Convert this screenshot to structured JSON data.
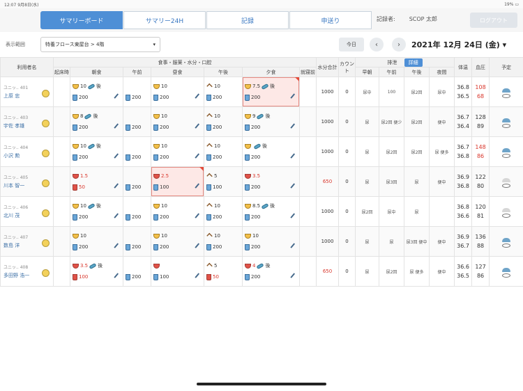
{
  "statusbar": {
    "time": "12:07  9月8日(水)",
    "battery": "19% ▭"
  },
  "tabs": [
    {
      "label": "サマリーボード"
    },
    {
      "label": "サマリー24H"
    },
    {
      "label": "記録"
    },
    {
      "label": "申送り"
    }
  ],
  "recorder": {
    "label": "記録者:",
    "name": "SCOP 太郎"
  },
  "logout_label": "ログアウト",
  "filter": {
    "label": "表示範囲",
    "value": "特養フロース東屋台 > 4階",
    "today_label": "今日"
  },
  "date": "2021年 12月 24日 (金) ▾",
  "headers": {
    "resident": "利用者名",
    "meal_group": "食事・服薬・水分・口腔",
    "wakeup": "起床時",
    "breakfast": "朝食",
    "am": "午前",
    "lunch": "昼食",
    "pm": "午後",
    "dinner": "夕食",
    "bedtime": "就寝前",
    "water_total": "水分合計",
    "count": "カウント",
    "excretion_group": "排泄",
    "detail": "詳細",
    "early": "早朝",
    "ex_am": "午前",
    "ex_pm": "午後",
    "night": "夜間",
    "temp": "体温",
    "bp": "血圧",
    "plan": "予定"
  },
  "rows": [
    {
      "unit": "ユニッ.. 401",
      "name": "上原 忠",
      "breakfast": [
        "10",
        "後",
        "200"
      ],
      "am": "200",
      "lunch": [
        "10",
        "200"
      ],
      "pm": [
        "10",
        "200"
      ],
      "dinner": [
        "7.5",
        "後",
        "200"
      ],
      "water_total": "1000",
      "count": "0",
      "early": "尿中",
      "ex_am": "100",
      "ex_pm": "尿2回",
      "night": "尿中",
      "temp": [
        "36.8",
        "36.5"
      ],
      "bp": [
        "108",
        "68"
      ],
      "bp_red": true
    },
    {
      "unit": "ユニッ.. 403",
      "name": "宇佐 孝雄",
      "breakfast": [
        "8",
        "後",
        "200"
      ],
      "am": "200",
      "lunch": [
        "10",
        "200"
      ],
      "pm": [
        "10",
        "200"
      ],
      "dinner": [
        "9",
        "後",
        "200"
      ],
      "water_total": "1000",
      "count": "0",
      "early": "尿",
      "ex_am": "尿2回 便少",
      "ex_pm": "尿2回",
      "night": "便中",
      "temp": [
        "36.7",
        "36.4"
      ],
      "bp": [
        "128",
        "89"
      ],
      "bp_red": false
    },
    {
      "unit": "ユニッ.. 404",
      "name": "小沢 勲",
      "breakfast": [
        "10",
        "後",
        "200"
      ],
      "am": "200",
      "lunch": [
        "10",
        "200"
      ],
      "pm": [
        "10",
        "200"
      ],
      "dinner": [
        "",
        "後",
        "200"
      ],
      "water_total": "1000",
      "count": "0",
      "early": "尿",
      "ex_am": "尿2回",
      "ex_pm": "尿2回",
      "night": "尿 便多",
      "temp": [
        "36.7",
        "36.8"
      ],
      "bp": [
        "148",
        "86"
      ],
      "bp_red": true
    },
    {
      "unit": "ユニッ.. 405",
      "name": "川本 智一",
      "breakfast": [
        "1.5",
        "",
        "50"
      ],
      "am": "200",
      "lunch": [
        "2.5",
        "100"
      ],
      "pm": [
        "5",
        "100"
      ],
      "dinner": [
        "3.5",
        "",
        "200"
      ],
      "water_total": "650",
      "count": "0",
      "early": "尿",
      "ex_am": "尿3回",
      "ex_pm": "尿",
      "night": "便中",
      "temp": [
        "36.9",
        "36.8"
      ],
      "bp": [
        "122",
        "80"
      ],
      "bp_red": false
    },
    {
      "unit": "ユニッ.. 406",
      "name": "北川 茂",
      "breakfast": [
        "10",
        "後",
        "200"
      ],
      "am": "200",
      "lunch": [
        "10",
        "200"
      ],
      "pm": [
        "10",
        "200"
      ],
      "dinner": [
        "8.5",
        "後",
        "200"
      ],
      "water_total": "1000",
      "count": "0",
      "early": "尿2回",
      "ex_am": "尿中",
      "ex_pm": "尿",
      "night": "",
      "temp": [
        "36.8",
        "36.6"
      ],
      "bp": [
        "120",
        "81"
      ],
      "bp_red": false
    },
    {
      "unit": "ユニッ.. 407",
      "name": "数島 洋",
      "breakfast": [
        "10",
        "",
        "200"
      ],
      "am": "200",
      "lunch": [
        "10",
        "200"
      ],
      "pm": [
        "10",
        "200"
      ],
      "dinner": [
        "10",
        "",
        "200"
      ],
      "water_total": "1000",
      "count": "0",
      "early": "尿",
      "ex_am": "尿",
      "ex_pm": "尿3回 便中",
      "night": "便中",
      "temp": [
        "36.9",
        "36.7"
      ],
      "bp": [
        "136",
        "88"
      ],
      "bp_red": false
    },
    {
      "unit": "ユニッ.. 408",
      "name": "多田野 浩一",
      "breakfast": [
        "3.5",
        "後",
        "100"
      ],
      "am": "200",
      "lunch": [
        "",
        "100"
      ],
      "pm": [
        "5",
        "50"
      ],
      "dinner": [
        "4",
        "後",
        "200"
      ],
      "water_total": "650",
      "count": "0",
      "early": "尿",
      "ex_am": "尿2回",
      "ex_pm": "尿 便多",
      "night": "便中",
      "temp": [
        "36.6",
        "36.5"
      ],
      "bp": [
        "127",
        "86"
      ],
      "bp_red": false
    }
  ]
}
